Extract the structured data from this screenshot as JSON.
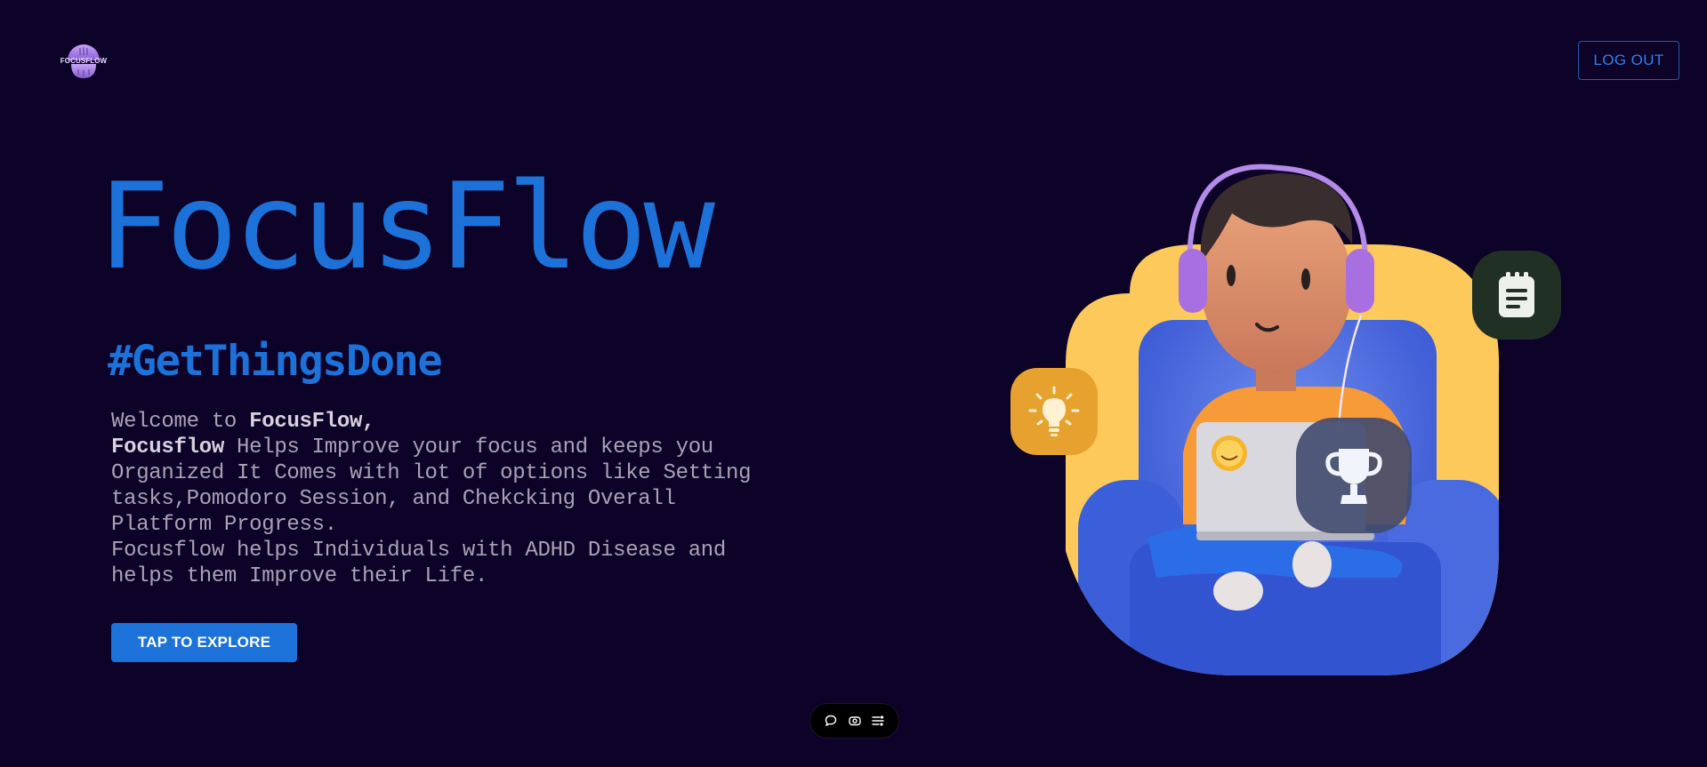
{
  "header": {
    "logo_text": "FOCUSFLOW",
    "logout_label": "LOG OUT"
  },
  "hero": {
    "title": "FocusFlow",
    "hashtag": "#GetThingsDone",
    "desc": {
      "l1_a": "Welcome to ",
      "l1_b": "FocusFlow",
      "l1_c": ",",
      "l2_a": "Focusflow",
      "l2_b": " Helps Improve your focus and keeps you",
      "l3": "Organized It Comes with lot of options like Setting",
      "l4": "tasks,Pomodoro Session, and Chekcking Overall",
      "l5": "Platform Progress.",
      "l6": "Focusflow helps Individuals with ADHD Disease and",
      "l7": "helps them Improve their Life."
    },
    "cta_label": "TAP TO EXPLORE"
  },
  "toolbar": {
    "icons": [
      "chat-icon",
      "capture-icon",
      "list-settings-icon"
    ]
  },
  "illustration": {
    "icons": [
      "notes-icon",
      "lightbulb-icon",
      "trophy-icon"
    ]
  },
  "colors": {
    "background": "#0d0228",
    "accent": "#1c72d8",
    "text_muted": "#a8a3b4",
    "yellow": "#fdc95a",
    "blue_chair": "#3b5fd9"
  }
}
